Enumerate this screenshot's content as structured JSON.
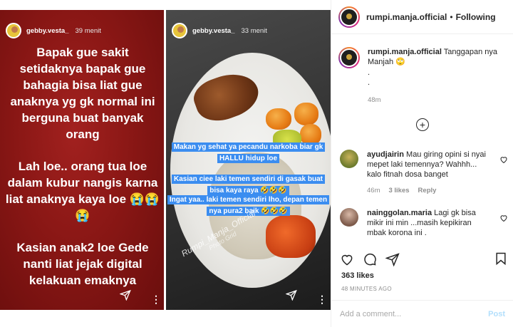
{
  "stories": [
    {
      "user": "gebby.vesta_",
      "time": "39 menit",
      "paragraphs": [
        "Bapak gue sakit setidaknya bapak gue bahagia bisa liat gue anaknya yg gk normal ini berguna buat banyak orang",
        "Lah loe.. orang tua loe dalam kubur nangis karna liat anaknya kaya loe 😭😭😭",
        "Kasian anak2 loe Gede nanti liat jejak digital kelakuan emaknya"
      ]
    },
    {
      "user": "gebby.vesta_",
      "time": "33 menit",
      "captions": [
        "Makan yg sehat ya pecandu narkoba biar gk HALLU hidup loe",
        "Kasian ciee laki temen sendiri di gasak buat bisa kaya raya 🤣🤣🤣",
        "Ingat yaa.. laki temen sendiri lho, depan temen nya pura2 baik 🤣🤣🤣"
      ],
      "watermark": "Rumpi_Manja_Official",
      "watermark_sub": "Photo Grid"
    }
  ],
  "header": {
    "username": "rumpi.manja.official",
    "separator": "•",
    "follow_label": "Following"
  },
  "post": {
    "username": "rumpi.manja.official",
    "caption": "Tanggapan nya Manjah 🙄",
    "dots": ". .",
    "time": "48m"
  },
  "load_more_icon": "plus-circle-icon",
  "comments": [
    {
      "username": "ayudjairin",
      "text": "Mau giring opini si nyai mepet laki temennya? Wahhh... kalo fitnah dosa banget",
      "time": "46m",
      "likes": "3 likes",
      "reply": "Reply",
      "avatar_color": "#6b7a2c"
    },
    {
      "username": "nainggolan.maria",
      "text": "Lagi gk bisa mikir ini min ...masih kepikiran mbak korona ini .",
      "avatar_color": "#7d5a4a"
    }
  ],
  "likes_count": "363 likes",
  "post_date": "48 MINUTES AGO",
  "add_comment": {
    "placeholder": "Add a comment...",
    "post_label": "Post"
  },
  "colors": {
    "story_red": "#8a1715",
    "caption_blue": "#3b8df0",
    "post_button": "#b2dffc"
  }
}
